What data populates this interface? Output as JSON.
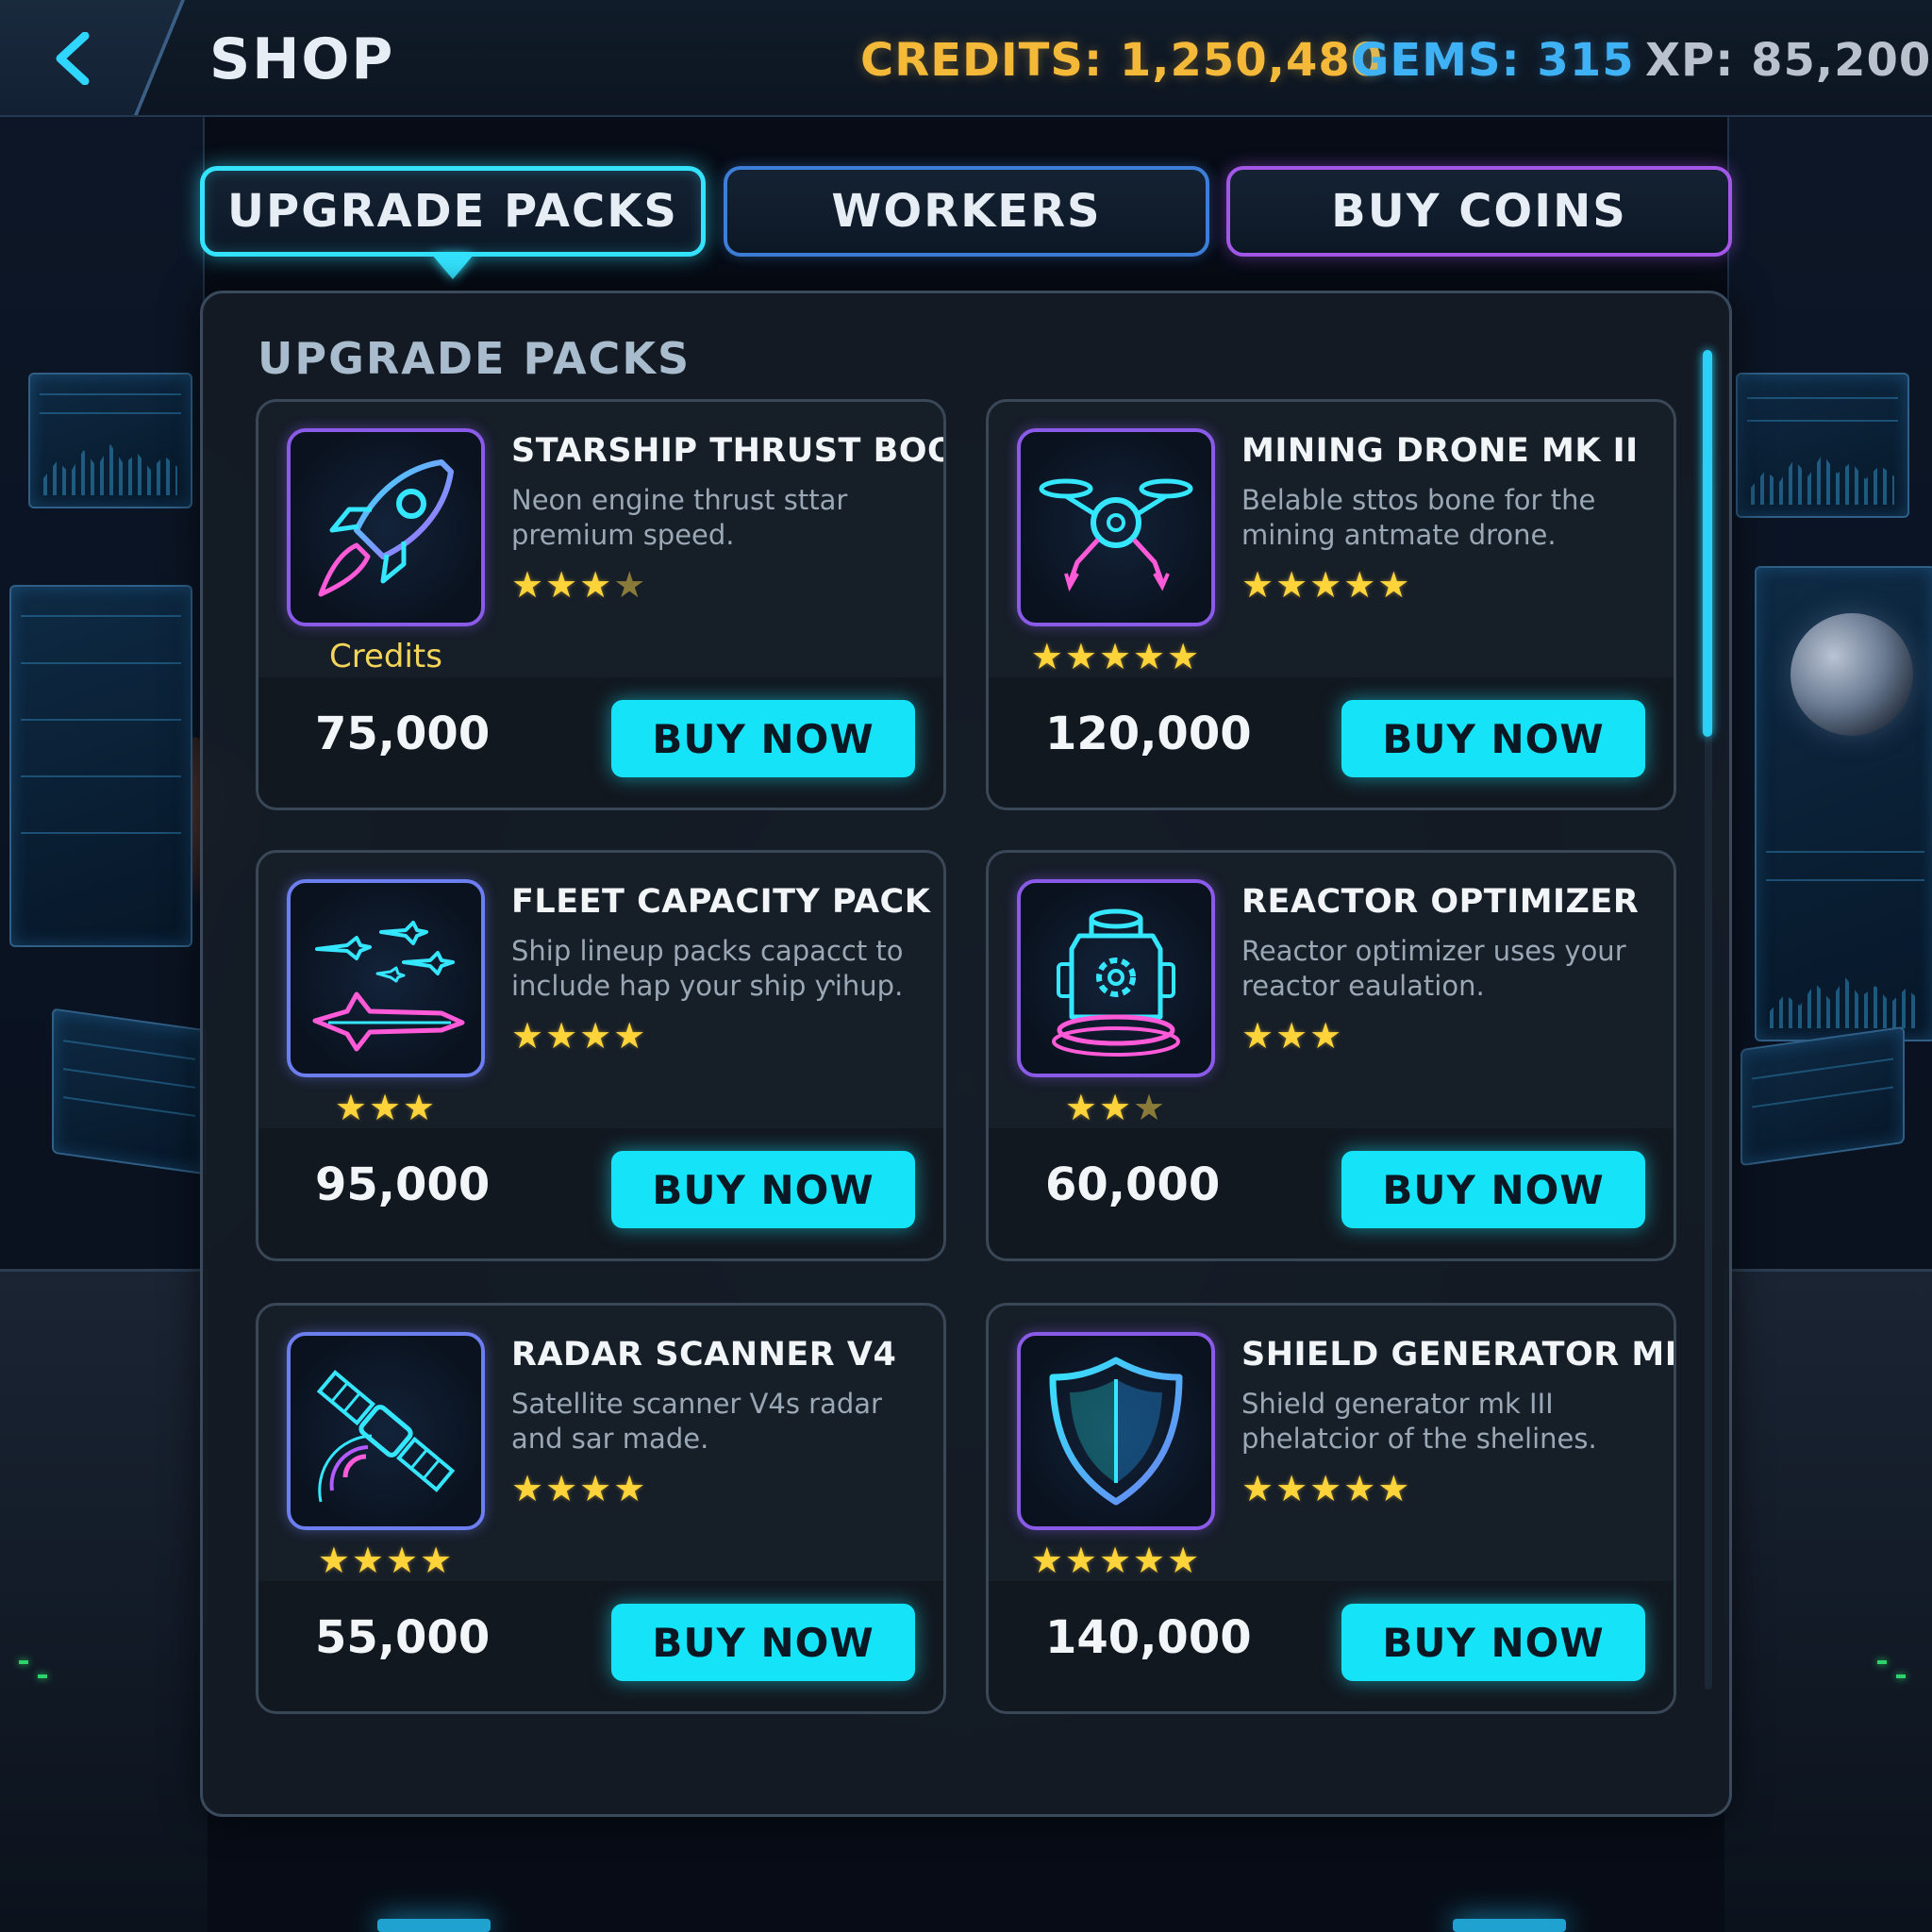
{
  "header": {
    "title": "SHOP",
    "credits": "CREDITS: 1,250,480",
    "gems": "GEMS: 315",
    "xp": "XP: 85,200"
  },
  "tabs": [
    {
      "label": "UPGRADE PACKS",
      "active": true
    },
    {
      "label": "WORKERS",
      "active": false
    },
    {
      "label": "BUY COINS",
      "active": false
    }
  ],
  "panel": {
    "title": "UPGRADE PACKS"
  },
  "buy_label": "BUY NOW",
  "items": [
    {
      "name": "STARSHIP THRUST BOOST",
      "desc": "Neon engine thrust sttar premium speed.",
      "rating": 3.5,
      "sub_label": "Credits",
      "price": "75,000",
      "icon": "rocket-icon"
    },
    {
      "name": "MINING DRONE MK II",
      "desc": "Belable sttos bone for the mining antmate drone.",
      "rating": 5,
      "sub_rating": 5,
      "price": "120,000",
      "icon": "drone-icon"
    },
    {
      "name": "FLEET CAPACITY PACK",
      "desc": "Ship lineup packs capacct to include hap your ship ƴihup.",
      "rating": 4,
      "sub_rating": 3,
      "price": "95,000",
      "icon": "fleet-icon"
    },
    {
      "name": "REACTOR OPTIMIZER",
      "desc": "Reactor optimizer uses your reactor eaulation.",
      "rating": 3,
      "sub_rating": 2.5,
      "price": "60,000",
      "icon": "reactor-icon"
    },
    {
      "name": "RADAR SCANNER V4",
      "desc": "Satellite scanner V4s radar and sar made.",
      "rating": 4,
      "sub_rating": 4,
      "price": "55,000",
      "icon": "satellite-icon"
    },
    {
      "name": "SHIELD GENERATOR MK III",
      "desc": "Shield generator mk III phelatcior of the shelines.",
      "rating": 5,
      "sub_rating": 5,
      "price": "140,000",
      "icon": "shield-icon"
    }
  ],
  "colors": {
    "accent": "#15e3f7",
    "credits": "#f5b93a",
    "gems": "#3fb2f5",
    "star": "#ffd43a",
    "tab_workers": "#3d7ed8",
    "tab_coins": "#a457e8"
  }
}
